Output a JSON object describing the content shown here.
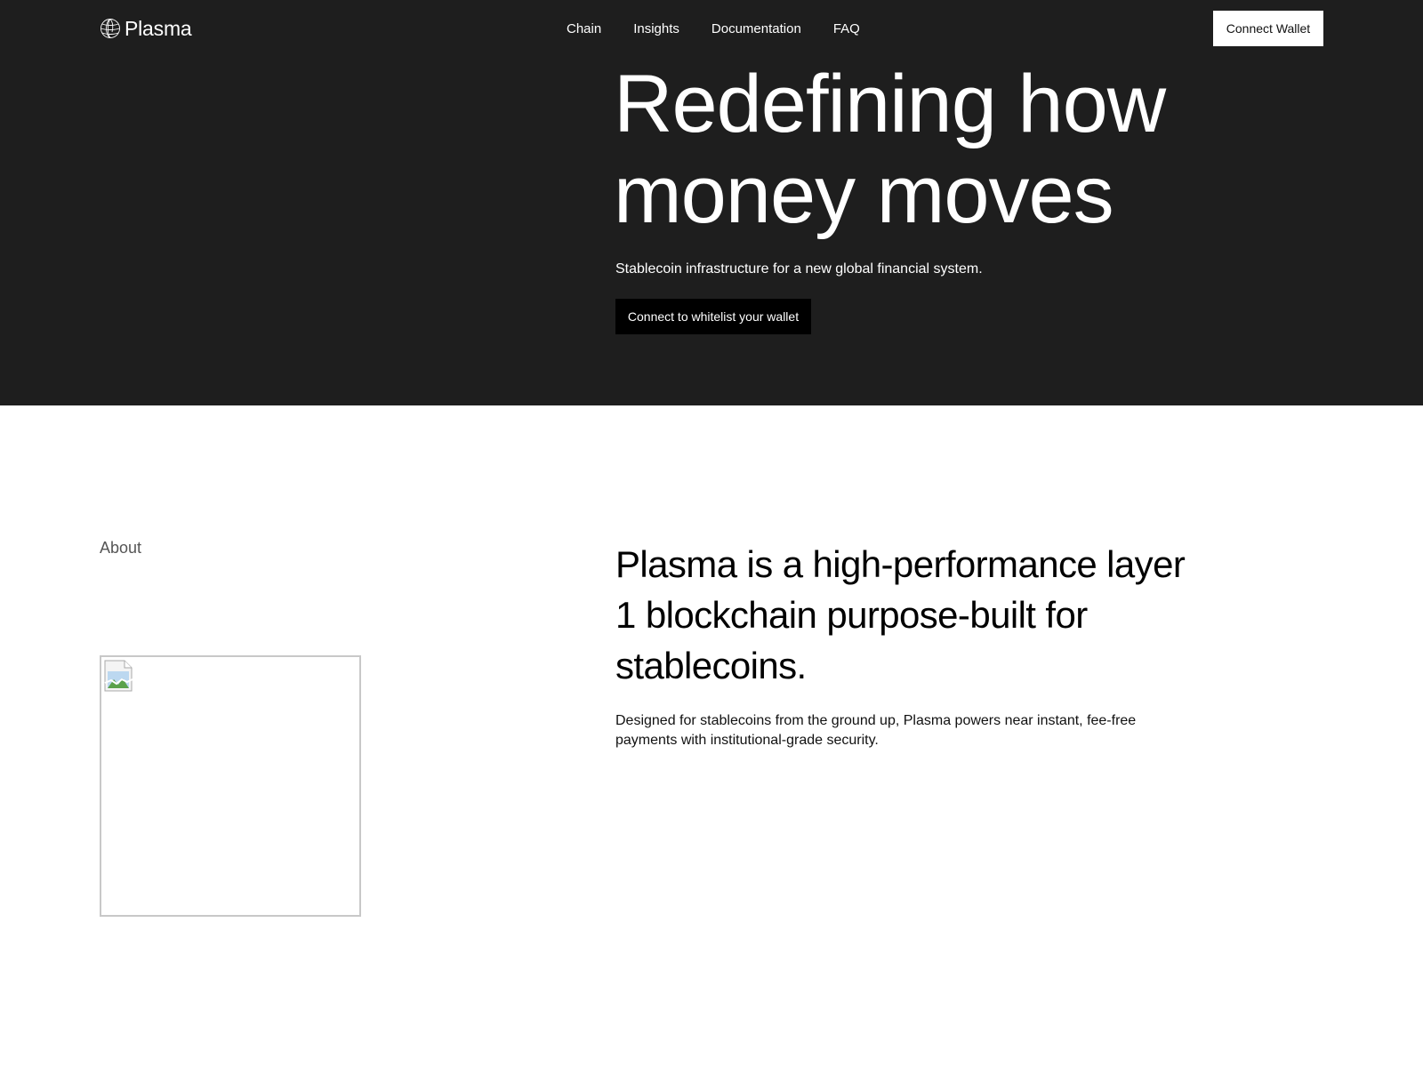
{
  "brand": {
    "name": "Plasma",
    "logo_icon": "plasma-sphere-icon"
  },
  "nav": {
    "links": [
      "Chain",
      "Insights",
      "Documentation",
      "FAQ"
    ],
    "connect_wallet_label": "Connect Wallet"
  },
  "hero": {
    "title": "Redefining how money moves",
    "subtitle": "Stablecoin infrastructure for a new global financial system.",
    "cta_label": "Connect to whitelist your wallet"
  },
  "about": {
    "label": "About",
    "image_icon": "broken-image-icon",
    "heading": "Plasma is a high-performance layer 1 blockchain purpose-built for stablecoins.",
    "description": "Designed for stablecoins from the ground up, Plasma powers near instant, fee-free payments with institutional-grade security."
  },
  "colors": {
    "hero_background": "#1e1e1e",
    "page_background": "#ffffff",
    "cta_background": "#000000",
    "about_label": "#555555"
  }
}
